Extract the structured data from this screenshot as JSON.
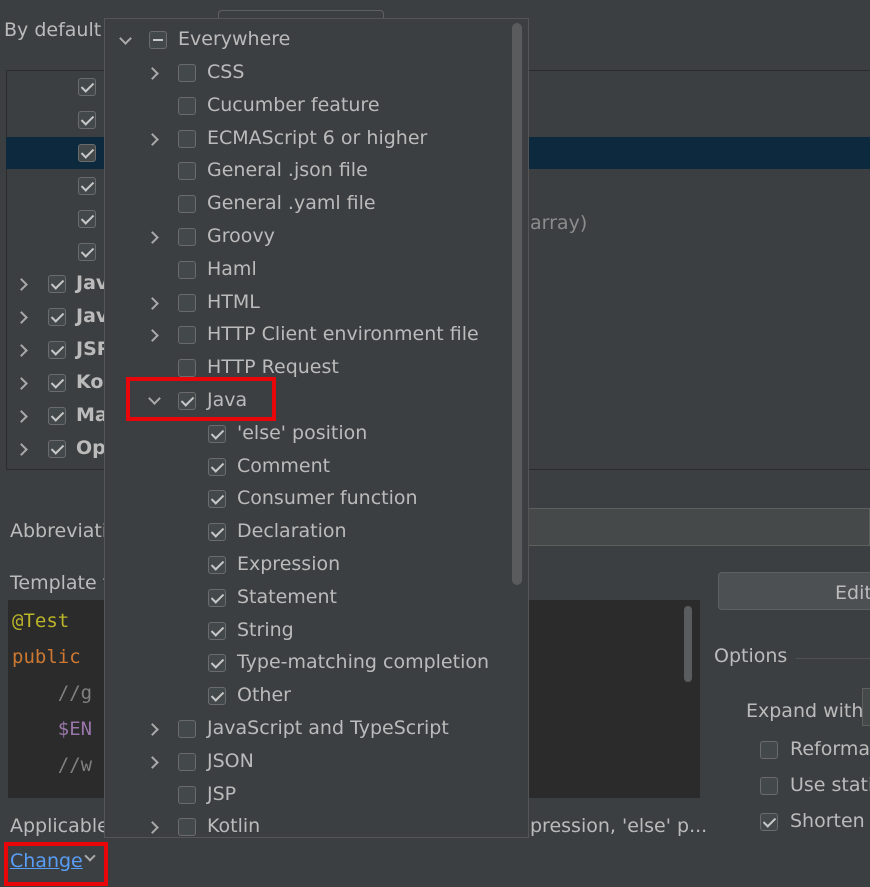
{
  "header": {
    "by_default_label": "By default e"
  },
  "background_list": {
    "selected_row_index": 2,
    "child_rows": [
      {
        "checked": true
      },
      {
        "checked": true
      },
      {
        "checked": true
      },
      {
        "checked": true
      },
      {
        "checked": true
      },
      {
        "checked": true
      }
    ],
    "groups": [
      {
        "label": "Jav",
        "checked": true
      },
      {
        "label": "Jav",
        "checked": true
      },
      {
        "label": "JSP",
        "checked": true
      },
      {
        "label": "Ko",
        "checked": true
      },
      {
        "label": "Ma",
        "checked": true
      },
      {
        "label": "Op",
        "checked": true
      }
    ],
    "right_fragment": "array)"
  },
  "abbreviation": {
    "label": "Abbreviatio"
  },
  "template": {
    "label": "Template t",
    "lines": [
      "@Test",
      "public",
      "    //g",
      "    $EN",
      "    //w"
    ]
  },
  "edit_button": {
    "label": "Edit"
  },
  "options": {
    "title": "Options",
    "expand_with_label": "Expand with",
    "checkboxes": [
      {
        "label": "Reformat",
        "checked": false
      },
      {
        "label": "Use static",
        "checked": false
      },
      {
        "label": "Shorten F",
        "checked": true
      }
    ]
  },
  "applicable": {
    "label": "Applicable",
    "suffix": "pression, 'else' p..."
  },
  "change_link": {
    "label": "Change"
  },
  "popup": {
    "root": {
      "label": "Everywhere",
      "state": "partial"
    },
    "items": [
      {
        "label": "CSS",
        "checked": false,
        "expander": "right",
        "indent": 1
      },
      {
        "label": "Cucumber feature",
        "checked": false,
        "expander": "none",
        "indent": 1
      },
      {
        "label": "ECMAScript 6 or higher",
        "checked": false,
        "expander": "right",
        "indent": 1
      },
      {
        "label": "General .json file",
        "checked": false,
        "expander": "none",
        "indent": 1
      },
      {
        "label": "General .yaml file",
        "checked": false,
        "expander": "none",
        "indent": 1
      },
      {
        "label": "Groovy",
        "checked": false,
        "expander": "right",
        "indent": 1
      },
      {
        "label": "Haml",
        "checked": false,
        "expander": "none",
        "indent": 1
      },
      {
        "label": "HTML",
        "checked": false,
        "expander": "right",
        "indent": 1
      },
      {
        "label": "HTTP Client environment file",
        "checked": false,
        "expander": "right",
        "indent": 1
      },
      {
        "label": "HTTP Request",
        "checked": false,
        "expander": "none",
        "indent": 1
      },
      {
        "label": "Java",
        "checked": true,
        "expander": "down",
        "indent": 1
      },
      {
        "label": "'else' position",
        "checked": true,
        "expander": "none",
        "indent": 2
      },
      {
        "label": "Comment",
        "checked": true,
        "expander": "none",
        "indent": 2
      },
      {
        "label": "Consumer function",
        "checked": true,
        "expander": "none",
        "indent": 2
      },
      {
        "label": "Declaration",
        "checked": true,
        "expander": "none",
        "indent": 2
      },
      {
        "label": "Expression",
        "checked": true,
        "expander": "none",
        "indent": 2
      },
      {
        "label": "Statement",
        "checked": true,
        "expander": "none",
        "indent": 2
      },
      {
        "label": "String",
        "checked": true,
        "expander": "none",
        "indent": 2
      },
      {
        "label": "Type-matching completion",
        "checked": true,
        "expander": "none",
        "indent": 2
      },
      {
        "label": "Other",
        "checked": true,
        "expander": "none",
        "indent": 2
      },
      {
        "label": "JavaScript and TypeScript",
        "checked": false,
        "expander": "right",
        "indent": 1
      },
      {
        "label": "JSON",
        "checked": false,
        "expander": "right",
        "indent": 1
      },
      {
        "label": "JSP",
        "checked": false,
        "expander": "none",
        "indent": 1
      },
      {
        "label": "Kotlin",
        "checked": false,
        "expander": "right",
        "indent": 1
      }
    ]
  },
  "highlights": [
    "java-item",
    "change-link"
  ],
  "colors": {
    "background": "#3c3f41",
    "selection": "#0d293e",
    "highlight": "#e8060a",
    "link": "#589df6",
    "keyword": "#cc7832",
    "annotation": "#bbb529",
    "comment": "#808080",
    "variable": "#9876aa"
  }
}
